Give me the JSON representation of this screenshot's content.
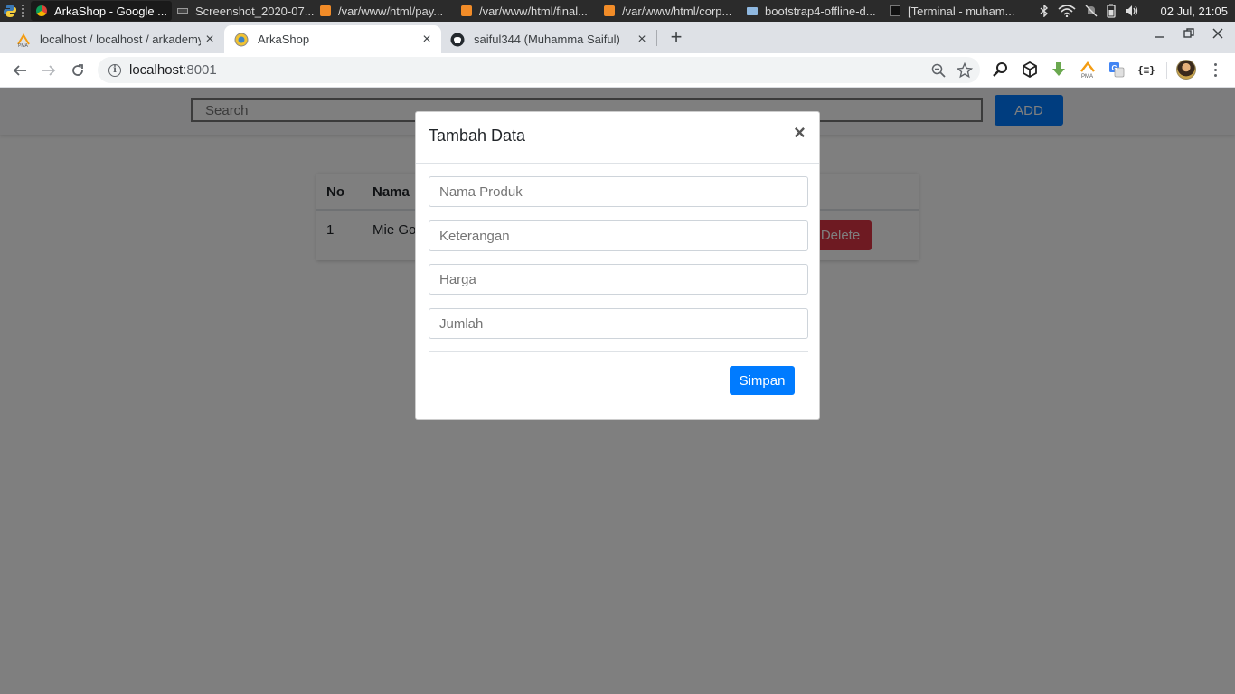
{
  "taskbar": {
    "tasks": [
      {
        "label": "ArkaShop - Google ...",
        "active": true
      },
      {
        "label": "Screenshot_2020-07...",
        "active": false
      },
      {
        "label": "/var/www/html/pay...",
        "active": false
      },
      {
        "label": "/var/www/html/final...",
        "active": false
      },
      {
        "label": "/var/www/html/corp...",
        "active": false
      },
      {
        "label": "bootstrap4-offline-d...",
        "active": false
      },
      {
        "label": "[Terminal - muham...",
        "active": false
      }
    ],
    "clock": "02 Jul, 21:05"
  },
  "browser": {
    "tabs": [
      {
        "title": "localhost / localhost / arkademy",
        "active": false
      },
      {
        "title": "ArkaShop",
        "active": true
      },
      {
        "title": "saiful344 (Muhamma Saiful)",
        "active": false
      }
    ],
    "tab_close": "×",
    "new_tab": "+",
    "url_host": "localhost",
    "url_port": ":8001"
  },
  "page": {
    "search_placeholder": "Search",
    "add_label": "ADD",
    "table": {
      "headers": [
        "No",
        "Nama"
      ],
      "rows": [
        {
          "no": "1",
          "nama": "Mie Go",
          "action": "Delete"
        }
      ]
    }
  },
  "modal": {
    "title": "Tambah Data",
    "close": "×",
    "fields": [
      {
        "placeholder": "Nama Produk"
      },
      {
        "placeholder": "Keterangan"
      },
      {
        "placeholder": "Harga"
      },
      {
        "placeholder": "Jumlah"
      }
    ],
    "submit_label": "Simpan"
  },
  "colors": {
    "primary": "#007bff",
    "danger": "#dc3545",
    "tabstrip": "#dee1e6"
  }
}
